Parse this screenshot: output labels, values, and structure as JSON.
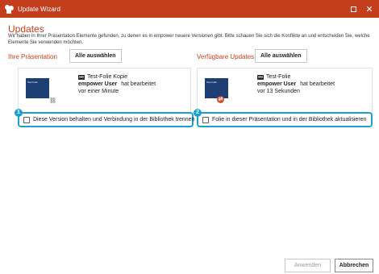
{
  "window": {
    "title": "Update Wizard",
    "app_icon": "powerpoint-shapes-icon",
    "maximize_icon": "maximize-icon",
    "close_icon": "close-icon",
    "close_glyph": "✕"
  },
  "updates": {
    "heading": "Updates",
    "description": "Wir haben in Ihrer Präsentation Elemente gefunden, zu denen es in empower neuere Versionen gibt. Bitte schauen Sie sich die Konflikte an und entscheiden Sie, welche Elemente Sie verwenden möchten."
  },
  "left": {
    "section_label": "Ihre Präsentation",
    "select_all_label": "Alle auswählen",
    "thumbnail_text": "Test Folie",
    "slide_name": "Test-Folie Kopie",
    "user": "empower User",
    "action": "hat bearbeitet",
    "time": "vor einer Minute",
    "status_icon": "link-icon",
    "status_glyph": "⛓",
    "badge": "1",
    "option_label": "Diese Version behalten und Verbindung in der Bibliothek trennen"
  },
  "right": {
    "section_label": "Verfügbare Updates",
    "select_all_label": "Alle auswählen",
    "thumbnail_text": "Test Folie",
    "slide_name": "Test-Folie",
    "user": "empower User",
    "action": "hat bearbeitet",
    "time": "vor 13 Sekunden",
    "status_icon": "update-icon",
    "status_glyph": "⇄",
    "badge": "2",
    "option_label": "Folie in dieser Präsentation und in der Bibliothek aktualisieren"
  },
  "footer": {
    "apply_label": "Anwenden",
    "cancel_label": "Abbrechen"
  },
  "colors": {
    "accent": "#c43e1c",
    "highlight": "#1ba1d1",
    "thumbnail": "#1d3f73"
  }
}
